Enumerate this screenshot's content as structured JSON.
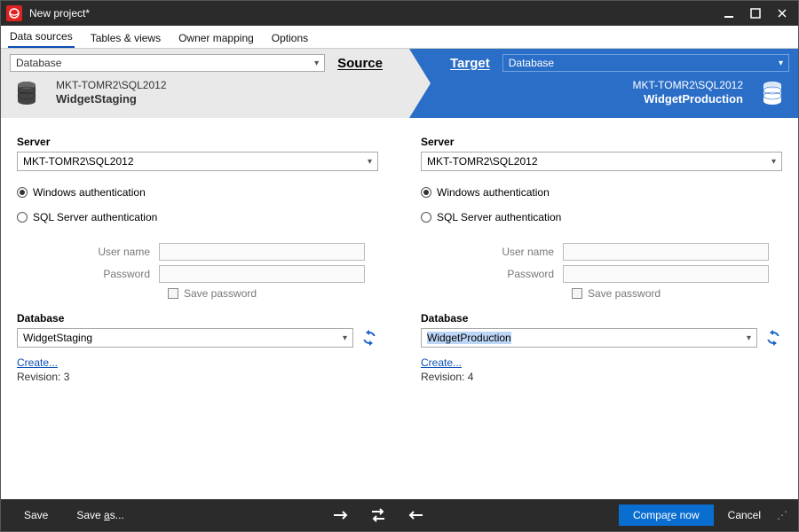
{
  "titlebar": {
    "title": "New project*"
  },
  "menu": {
    "data_sources": "Data sources",
    "tables_views": "Tables & views",
    "owner_mapping": "Owner mapping",
    "options": "Options"
  },
  "arrow": {
    "source_type_label": "Database",
    "target_type_label": "Database",
    "source_label": "Source",
    "target_label": "Target",
    "source": {
      "server": "MKT-TOMR2\\SQL2012",
      "db": "WidgetStaging"
    },
    "target": {
      "server": "MKT-TOMR2\\SQL2012",
      "db": "WidgetProduction"
    }
  },
  "labels": {
    "server": "Server",
    "database": "Database",
    "win_auth": "Windows authentication",
    "sql_auth": "SQL Server authentication",
    "user_name": "User name",
    "password": "Password",
    "save_password": "Save password",
    "create": "Create...",
    "revision_prefix": "Revision: "
  },
  "source": {
    "server": "MKT-TOMR2\\SQL2012",
    "db_selected": "WidgetStaging",
    "revision": "3",
    "auth": "windows"
  },
  "target": {
    "server": "MKT-TOMR2\\SQL2012",
    "db_selected": "WidgetProduction",
    "revision": "4",
    "auth": "windows"
  },
  "bottom": {
    "save": "Save",
    "save_as_prefix": "Save ",
    "save_as_u": "a",
    "save_as_suffix": "s...",
    "compare_prefix": "Compa",
    "compare_u": "r",
    "compare_suffix": "e now",
    "cancel": "Cancel"
  }
}
